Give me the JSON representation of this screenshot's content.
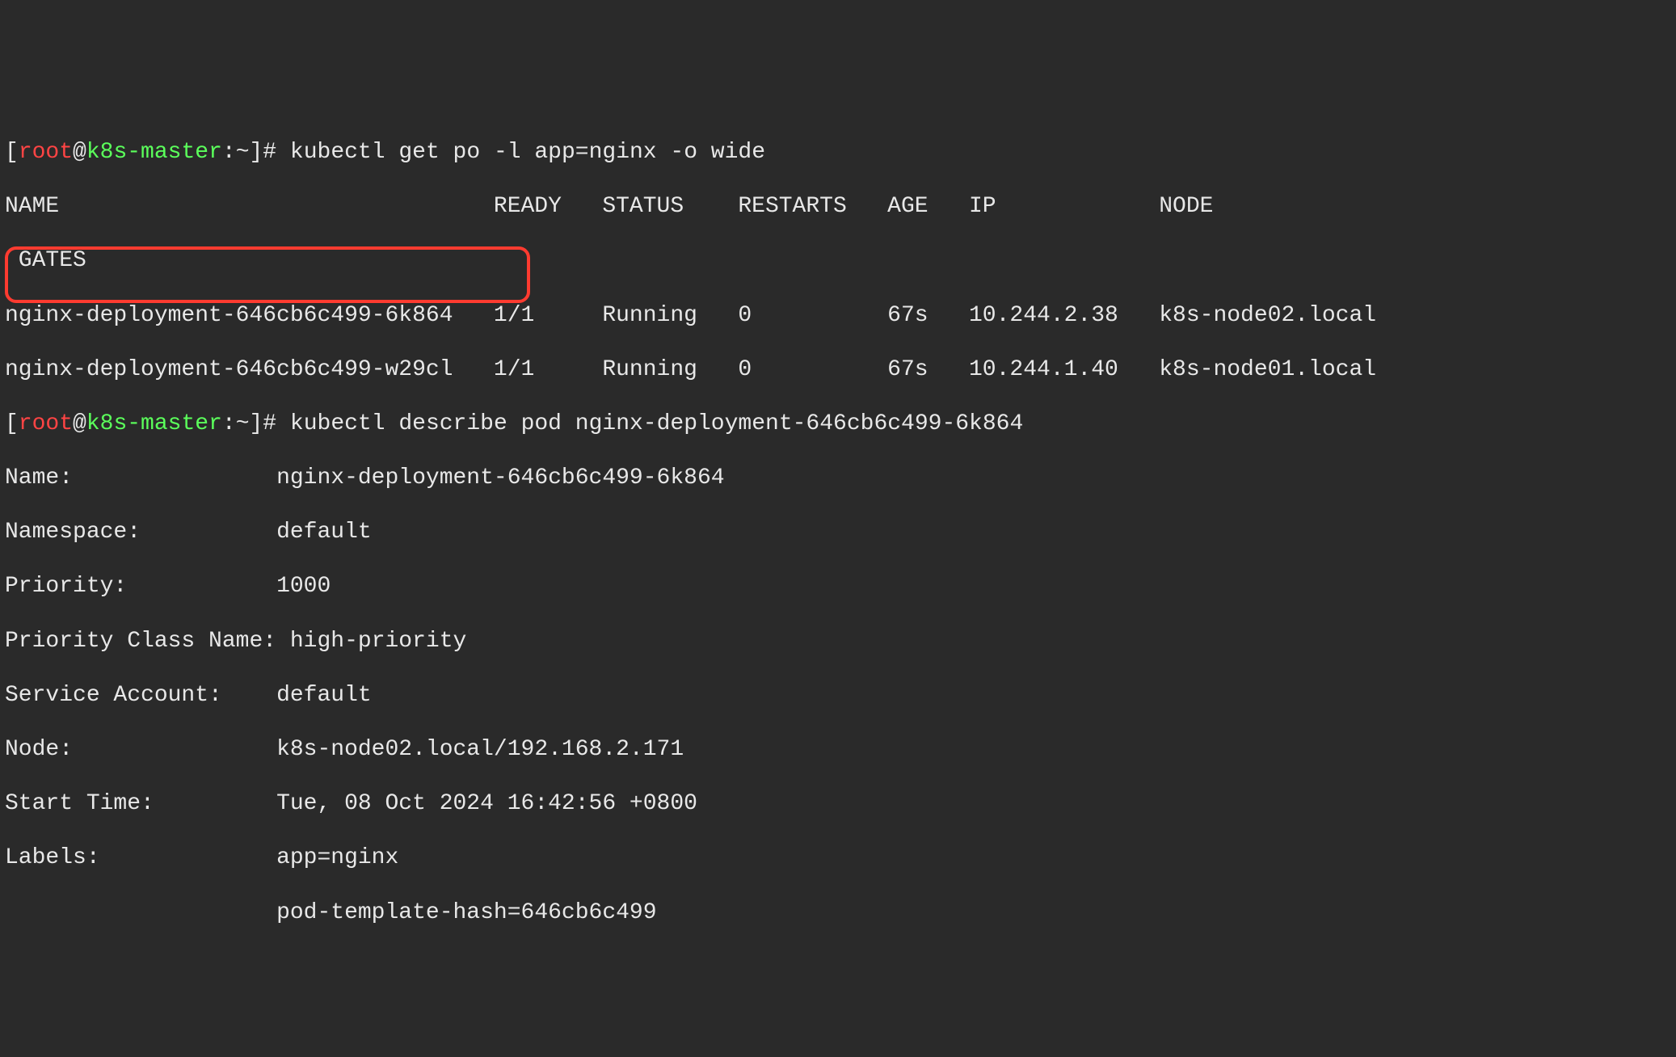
{
  "prompt": {
    "open": "[",
    "user": "root",
    "at": "@",
    "host": "k8s-master",
    "path": "~",
    "close": "]# "
  },
  "commands": {
    "cmd1": "kubectl get po -l app=nginx -o wide",
    "cmd2": "kubectl describe pod nginx-deployment-646cb6c499-6k864"
  },
  "table": {
    "header_line1": "NAME                                READY   STATUS    RESTARTS   AGE   IP            NODE",
    "header_line2": " GATES",
    "rows": [
      "nginx-deployment-646cb6c499-6k864   1/1     Running   0          67s   10.244.2.38   k8s-node02.local",
      "nginx-deployment-646cb6c499-w29cl   1/1     Running   0          67s   10.244.1.40   k8s-node01.local"
    ]
  },
  "describe": {
    "name_key": "Name:               ",
    "name_val": "nginx-deployment-646cb6c499-6k864",
    "ns_key": "Namespace:          ",
    "ns_val": "default",
    "prio_key": "Priority:           ",
    "prio_val": "1000",
    "pcn_key": "Priority Class Name:",
    "pcn_val": "high-priority",
    "sa_key": "Service Account:    ",
    "sa_val": "default",
    "node_key": "Node:               ",
    "node_val": "k8s-node02.local/192.168.2.171",
    "st_key": "Start Time:         ",
    "st_val": "Tue, 08 Oct 2024 16:42:56 +0800",
    "labels_key": "Labels:             ",
    "labels_val": "app=nginx",
    "labels2_pad": "                    ",
    "labels2_val": "pod-template-hash=646cb6c499"
  }
}
